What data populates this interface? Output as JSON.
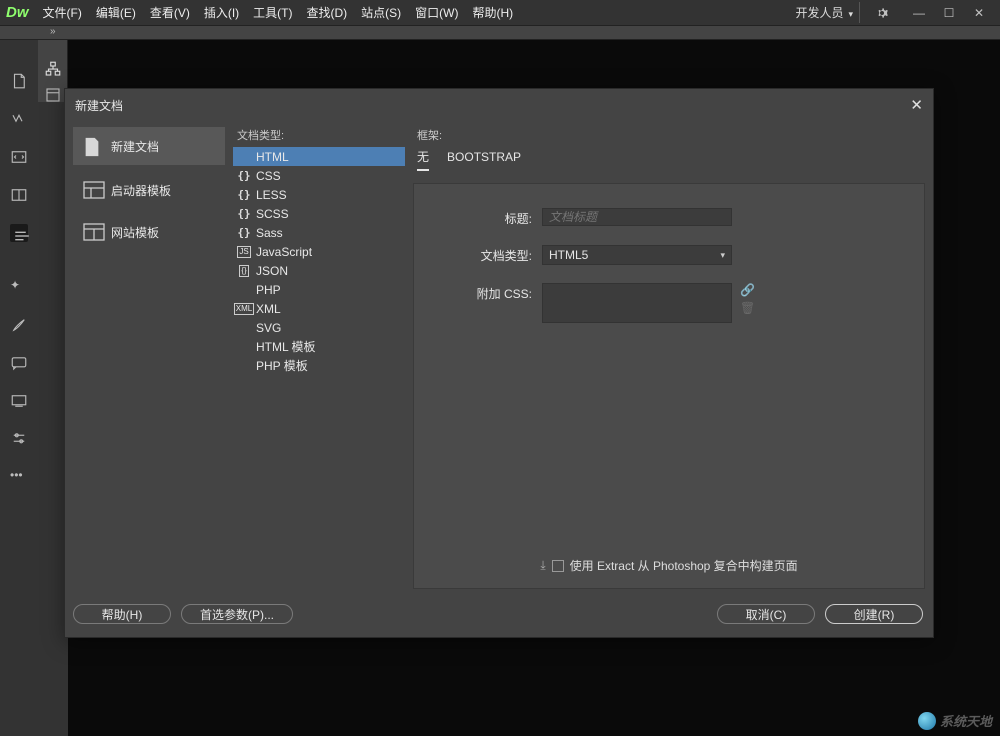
{
  "app": {
    "logo": "Dw"
  },
  "menubar": {
    "items": [
      "文件(F)",
      "编辑(E)",
      "查看(V)",
      "插入(I)",
      "工具(T)",
      "查找(D)",
      "站点(S)",
      "窗口(W)",
      "帮助(H)"
    ],
    "developer": "开发人员"
  },
  "dialog": {
    "title": "新建文档",
    "categories": [
      {
        "label": "新建文档",
        "selected": true
      },
      {
        "label": "启动器模板",
        "selected": false
      },
      {
        "label": "网站模板",
        "selected": false
      }
    ],
    "doctype_label": "文档类型:",
    "doctypes": [
      {
        "icon": "</>",
        "label": "HTML",
        "selected": true
      },
      {
        "icon": "{}",
        "label": "CSS"
      },
      {
        "icon": "{}",
        "label": "LESS"
      },
      {
        "icon": "{}",
        "label": "SCSS"
      },
      {
        "icon": "{}",
        "label": "Sass"
      },
      {
        "icon": "JS",
        "label": "JavaScript",
        "boxed": true
      },
      {
        "icon": "{}",
        "label": "JSON",
        "boxed": true
      },
      {
        "icon": "<?>",
        "label": "PHP"
      },
      {
        "icon": "XML",
        "label": "XML",
        "boxed": true
      },
      {
        "icon": "</>",
        "label": "SVG"
      },
      {
        "icon": "</>",
        "label": "HTML 模板"
      },
      {
        "icon": "<?>",
        "label": "PHP 模板"
      }
    ],
    "framework_label": "框架:",
    "tabs": [
      {
        "label": "无",
        "active": true
      },
      {
        "label": "BOOTSTRAP",
        "active": false
      }
    ],
    "form": {
      "title_label": "标题:",
      "title_placeholder": "文档标题",
      "doctype_label": "文档类型:",
      "doctype_value": "HTML5",
      "attach_css_label": "附加 CSS:",
      "extract_label": "使用 Extract 从 Photoshop 复合中构建页面"
    },
    "footer": {
      "help": "帮助(H)",
      "prefs": "首选参数(P)...",
      "cancel": "取消(C)",
      "create": "创建(R)"
    }
  },
  "watermark": "系统天地"
}
